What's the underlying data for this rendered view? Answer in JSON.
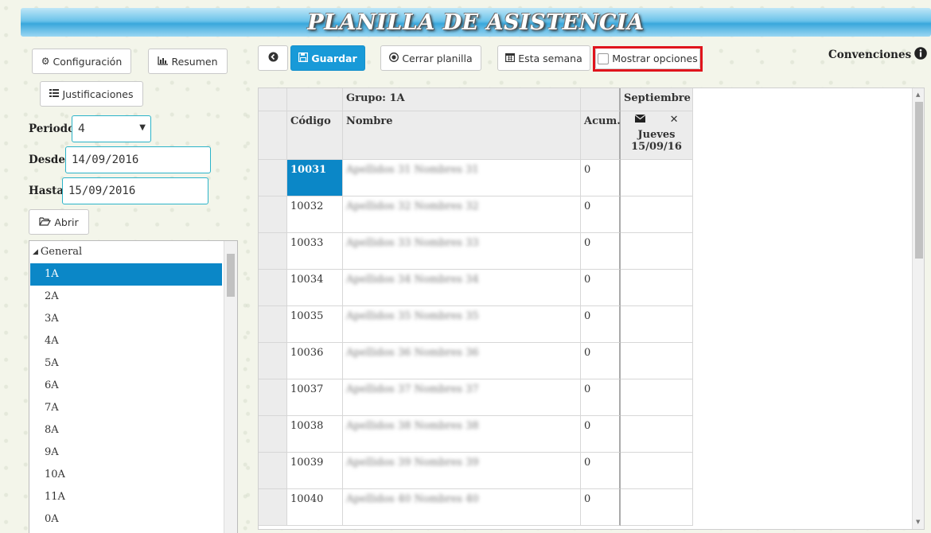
{
  "header": {
    "title": "PLANILLA DE ASISTENCIA"
  },
  "left": {
    "config_button": "Configuración",
    "resumen_button": "Resumen",
    "justificaciones_button": "Justificaciones",
    "periodo_label": "Periodo",
    "periodo_value": "4",
    "desde_label": "Desde",
    "desde_value": "14/09/2016",
    "hasta_label": "Hasta",
    "hasta_value": "15/09/2016",
    "abrir_button": "Abrir"
  },
  "tree": {
    "root_label": "General",
    "items": [
      "1A",
      "2A",
      "3A",
      "4A",
      "5A",
      "6A",
      "7A",
      "8A",
      "9A",
      "10A",
      "11A",
      "0A"
    ],
    "selected": "1A"
  },
  "toolbar": {
    "guardar": "Guardar",
    "cerrar_planilla": "Cerrar planilla",
    "esta_semana": "Esta semana",
    "mostrar_opciones": "Mostrar opciones",
    "convenciones": "Convenciones"
  },
  "table": {
    "group_label": "Grupo: 1A",
    "month_label": "Septiembre",
    "col_codigo": "Código",
    "col_nombre": "Nombre",
    "col_acum": "Acum.",
    "day_name": "Jueves",
    "day_date": "15/09/16",
    "rows": [
      {
        "codigo": "10031",
        "nombre": "Apellidos 31 Nombres 31",
        "acum": "0"
      },
      {
        "codigo": "10032",
        "nombre": "Apellidos 32 Nombres 32",
        "acum": "0"
      },
      {
        "codigo": "10033",
        "nombre": "Apellidos 33 Nombres 33",
        "acum": "0"
      },
      {
        "codigo": "10034",
        "nombre": "Apellidos 34 Nombres 34",
        "acum": "0"
      },
      {
        "codigo": "10035",
        "nombre": "Apellidos 35 Nombres 35",
        "acum": "0"
      },
      {
        "codigo": "10036",
        "nombre": "Apellidos 36 Nombres 36",
        "acum": "0"
      },
      {
        "codigo": "10037",
        "nombre": "Apellidos 37 Nombres 37",
        "acum": "0"
      },
      {
        "codigo": "10038",
        "nombre": "Apellidos 38 Nombres 38",
        "acum": "0"
      },
      {
        "codigo": "10039",
        "nombre": "Apellidos 39 Nombres 39",
        "acum": "0"
      },
      {
        "codigo": "10040",
        "nombre": "Apellidos 40 Nombres 40",
        "acum": "0"
      }
    ]
  },
  "colors": {
    "accent": "#189ad8",
    "selection": "#0b87c7",
    "highlight": "#e0141c"
  }
}
